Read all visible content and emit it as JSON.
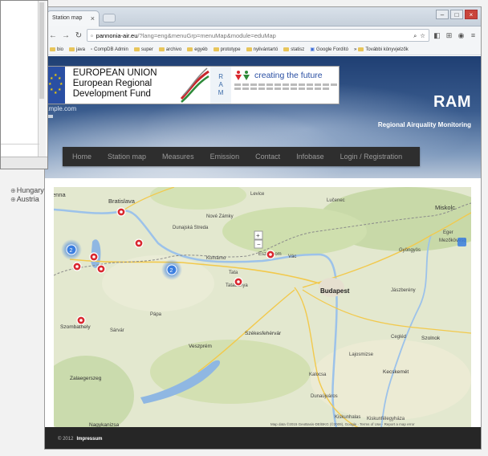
{
  "browser": {
    "tab_title": "Station map",
    "tab_close": "×",
    "window_controls": [
      "–",
      "□",
      "×"
    ],
    "url_host": "pannonia-air.eu",
    "url_path": "/?lang=eng&menuGrp=menuMap&module=eduMap",
    "bookmarks": [
      "bio",
      "java",
      "CompDB Admin",
      "super",
      "archivo",
      "egyéb",
      "prototype",
      "nyilvántartó",
      "statisz",
      "Google Fordító",
      "További könyvjelzők"
    ]
  },
  "site": {
    "eu_banner_lines": [
      "EUROPEAN UNION",
      "European Regional",
      "Development Fund"
    ],
    "ctf_text": "creating the future",
    "site_link": "ample.com",
    "title": "RAM",
    "subtitle": "Regional Airquality Monitoring",
    "nav": [
      "Home",
      "Station map",
      "Measures",
      "Emission",
      "Contact",
      "Infobase",
      "Login / Registration"
    ]
  },
  "tree": {
    "items": [
      "Hungary",
      "Austria"
    ]
  },
  "map": {
    "close_label": "×",
    "city_labels": {
      "bratislava": "Bratislava",
      "vienna": "enna",
      "miskolc": "Miskolc",
      "budapest": "Budapest",
      "komarno": "Komárno",
      "esztergom": "Esztergom",
      "tata": "Tata",
      "tatabanya": "Tatabánya",
      "szombathely": "Szombathely",
      "papa": "Pápa",
      "veszprem": "Veszprém",
      "szekesfehervar": "Székesfehérvár",
      "zalaegerszeg": "Zalaegerszeg",
      "kecskemet": "Kecskemét",
      "szolnok": "Szolnok",
      "cegled": "Cegléd",
      "jaszbereny": "Jászberény",
      "gyongyos": "Gyöngyös",
      "eger": "Eger",
      "nagykanizsa": "Nagykanizsa",
      "dunaujvaros": "Dunaújváros",
      "nove_zamky": "Nové Zámky",
      "kiskunfelegyhaza": "Kiskunfélegyháza",
      "kiskunhalas": "Kiskunhalas",
      "mezokovesd": "Mezőkövesd",
      "vac": "Vác",
      "lucenec": "Lučenec",
      "levice": "Levice",
      "sarvar": "Sárvár",
      "kalocsa": "Kalocsa",
      "lajosmizse": "Lajosmizse",
      "dunajska_streda": "Dunajská Streda"
    },
    "cluster_labels": [
      "2",
      "2"
    ],
    "attribution": "Map data ©2015 GeoBasis-DE/BKG (©2009), Google · Terms of Use · Report a map error"
  },
  "footer": {
    "copyright": "© 2012",
    "link": "Impressum"
  },
  "colors": {
    "nav_bg": "#2e2e2e",
    "marker": "#d9282f",
    "cluster": "#3b7ee0",
    "footer_bg": "#262626"
  }
}
